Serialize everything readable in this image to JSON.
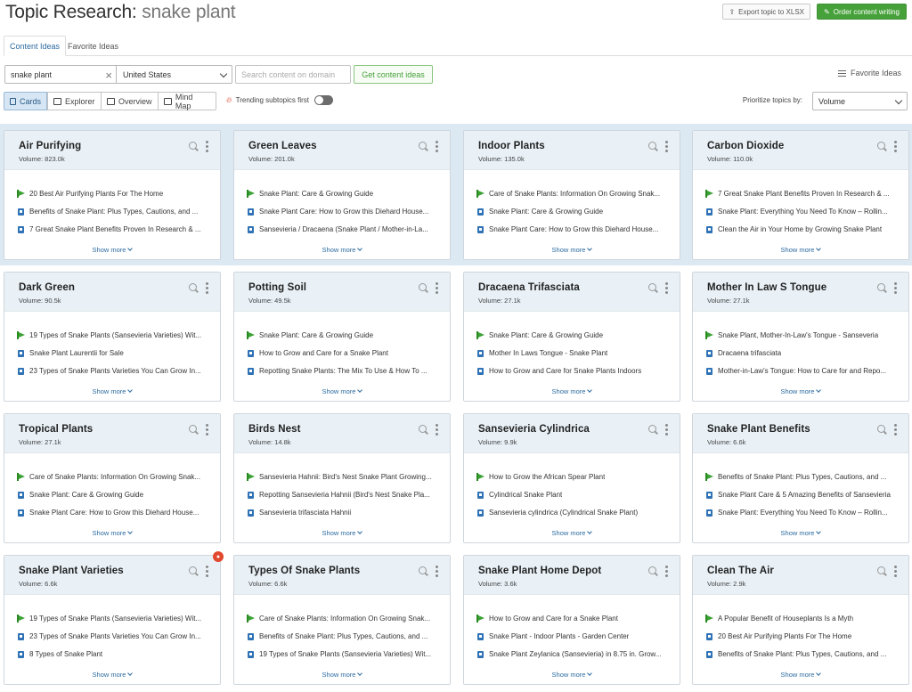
{
  "header": {
    "title_prefix": "Topic Research:",
    "keyword": "snake plant",
    "export_label": "Export topic to XLSX",
    "order_label": "Order content writing"
  },
  "tabs": [
    {
      "label": "Content Ideas",
      "active": true
    },
    {
      "label": "Favorite Ideas",
      "active": false
    }
  ],
  "search": {
    "keyword_value": "snake plant",
    "country_value": "United States",
    "domain_placeholder": "Search content on domain",
    "get_ideas_label": "Get content ideas",
    "favorite_ideas_label": "Favorite Ideas"
  },
  "views": [
    {
      "label": "Cards",
      "icon": "cards-icon",
      "active": true
    },
    {
      "label": "Explorer",
      "icon": "table-icon",
      "active": false
    },
    {
      "label": "Overview",
      "icon": "overview-icon",
      "active": false
    },
    {
      "label": "Mind Map",
      "icon": "mindmap-icon",
      "active": false
    }
  ],
  "trending_label": "Trending subtopics first",
  "trending_on": false,
  "prioritize_label": "Prioritize topics by:",
  "prioritize_value": "Volume",
  "colors": {
    "green": "#47a13b",
    "blue": "#2c6ba0",
    "header_bg": "#e9f1f7",
    "band_bg": "#dce8f2"
  },
  "cards": [
    {
      "title": "Air Purifying",
      "volume": "Volume: 823.0k",
      "items": [
        {
          "type": "green",
          "text": "20 Best Air Purifying Plants For The Home"
        },
        {
          "type": "blue",
          "text": "Benefits of Snake Plant: Plus Types, Cautions, and ..."
        },
        {
          "type": "blue",
          "text": "7 Great Snake Plant Benefits Proven In Research & ..."
        }
      ],
      "show_more": "Show more"
    },
    {
      "title": "Green Leaves",
      "volume": "Volume: 201.0k",
      "items": [
        {
          "type": "green",
          "text": "Snake Plant: Care & Growing Guide"
        },
        {
          "type": "blue",
          "text": "Snake Plant Care: How to Grow this Diehard House..."
        },
        {
          "type": "blue",
          "text": "Sansevieria / Dracaena (Snake Plant / Mother-in-La..."
        }
      ],
      "show_more": "Show more"
    },
    {
      "title": "Indoor Plants",
      "volume": "Volume: 135.0k",
      "items": [
        {
          "type": "green",
          "text": "Care of Snake Plants: Information On Growing Snak..."
        },
        {
          "type": "blue",
          "text": "Snake Plant: Care & Growing Guide"
        },
        {
          "type": "blue",
          "text": "Snake Plant Care: How to Grow this Diehard House..."
        }
      ],
      "show_more": "Show more"
    },
    {
      "title": "Carbon Dioxide",
      "volume": "Volume: 110.0k",
      "items": [
        {
          "type": "green",
          "text": "7 Great Snake Plant Benefits Proven In Research & ..."
        },
        {
          "type": "blue",
          "text": "Snake Plant: Everything You Need To Know – Rollin..."
        },
        {
          "type": "blue",
          "text": "Clean the Air in Your Home by Growing Snake Plant"
        }
      ],
      "show_more": "Show more"
    },
    {
      "title": "Dark Green",
      "volume": "Volume: 90.5k",
      "items": [
        {
          "type": "green",
          "text": "19 Types of Snake Plants (Sansevieria Varieties) Wit..."
        },
        {
          "type": "blue",
          "text": "Snake Plant Laurentii for Sale"
        },
        {
          "type": "blue",
          "text": "23 Types of Snake Plants Varieties You Can Grow In..."
        }
      ],
      "show_more": "Show more"
    },
    {
      "title": "Potting Soil",
      "volume": "Volume: 49.5k",
      "items": [
        {
          "type": "green",
          "text": "Snake Plant: Care & Growing Guide"
        },
        {
          "type": "blue",
          "text": "How to Grow and Care for a Snake Plant"
        },
        {
          "type": "blue",
          "text": "Repotting Snake Plants: The Mix To Use & How To ..."
        }
      ],
      "show_more": "Show more"
    },
    {
      "title": "Dracaena Trifasciata",
      "volume": "Volume: 27.1k",
      "items": [
        {
          "type": "green",
          "text": "Snake Plant: Care & Growing Guide"
        },
        {
          "type": "blue",
          "text": "Mother In Laws Tongue - Snake Plant"
        },
        {
          "type": "blue",
          "text": "How to Grow and Care for Snake Plants Indoors"
        }
      ],
      "show_more": "Show more"
    },
    {
      "title": "Mother In Law S Tongue",
      "volume": "Volume: 27.1k",
      "items": [
        {
          "type": "green",
          "text": "Snake Plant, Mother-In-Law's Tongue - Sanseveria"
        },
        {
          "type": "blue",
          "text": "Dracaena trifasciata"
        },
        {
          "type": "blue",
          "text": "Mother-in-Law's Tongue: How to Care for and Repo..."
        }
      ],
      "show_more": "Show more"
    },
    {
      "title": "Tropical Plants",
      "volume": "Volume: 27.1k",
      "items": [
        {
          "type": "green",
          "text": "Care of Snake Plants: Information On Growing Snak..."
        },
        {
          "type": "blue",
          "text": "Snake Plant: Care & Growing Guide"
        },
        {
          "type": "blue",
          "text": "Snake Plant Care: How to Grow this Diehard House..."
        }
      ],
      "show_more": "Show more"
    },
    {
      "title": "Birds Nest",
      "volume": "Volume: 14.8k",
      "items": [
        {
          "type": "green",
          "text": "Sansevieria Hahnii: Bird's Nest Snake Plant Growing..."
        },
        {
          "type": "blue",
          "text": "Repotting Sansevieria Hahnii (Bird's Nest Snake Pla..."
        },
        {
          "type": "blue",
          "text": "Sansevieria trifasciata Hahnii"
        }
      ],
      "show_more": "Show more"
    },
    {
      "title": "Sansevieria Cylindrica",
      "volume": "Volume: 9.9k",
      "items": [
        {
          "type": "green",
          "text": "How to Grow the African Spear Plant"
        },
        {
          "type": "blue",
          "text": "Cylindrical Snake Plant"
        },
        {
          "type": "blue",
          "text": "Sansevieria cylindrica (Cylindrical Snake Plant)"
        }
      ],
      "show_more": "Show more"
    },
    {
      "title": "Snake Plant Benefits",
      "volume": "Volume: 6.6k",
      "items": [
        {
          "type": "green",
          "text": "Benefits of Snake Plant: Plus Types, Cautions, and ..."
        },
        {
          "type": "blue",
          "text": "Snake Plant Care & 5 Amazing Benefits of Sansevieria"
        },
        {
          "type": "blue",
          "text": "Snake Plant: Everything You Need To Know – Rollin..."
        }
      ],
      "show_more": "Show more"
    },
    {
      "title": "Snake Plant Varieties",
      "volume": "Volume: 6.6k",
      "trending": true,
      "items": [
        {
          "type": "green",
          "text": "19 Types of Snake Plants (Sansevieria Varieties) Wit..."
        },
        {
          "type": "blue",
          "text": "23 Types of Snake Plants Varieties You Can Grow In..."
        },
        {
          "type": "blue",
          "text": "8 Types of Snake Plant"
        }
      ],
      "show_more": "Show more"
    },
    {
      "title": "Types Of Snake Plants",
      "volume": "Volume: 6.6k",
      "items": [
        {
          "type": "green",
          "text": "Care of Snake Plants: Information On Growing Snak..."
        },
        {
          "type": "blue",
          "text": "Benefits of Snake Plant: Plus Types, Cautions, and ..."
        },
        {
          "type": "blue",
          "text": "19 Types of Snake Plants (Sansevieria Varieties) Wit..."
        }
      ],
      "show_more": "Show more"
    },
    {
      "title": "Snake Plant Home Depot",
      "volume": "Volume: 3.6k",
      "items": [
        {
          "type": "green",
          "text": "How to Grow and Care for a Snake Plant"
        },
        {
          "type": "blue",
          "text": "Snake Plant - Indoor Plants - Garden Center"
        },
        {
          "type": "blue",
          "text": "Snake Plant Zeylanica (Sansevieria) in 8.75 in. Grow..."
        }
      ],
      "show_more": "Show more"
    },
    {
      "title": "Clean The Air",
      "volume": "Volume: 2.9k",
      "items": [
        {
          "type": "green",
          "text": "A Popular Benefit of Houseplants Is a Myth"
        },
        {
          "type": "blue",
          "text": "20 Best Air Purifying Plants For The Home"
        },
        {
          "type": "blue",
          "text": "Benefits of Snake Plant: Plus Types, Cautions, and ..."
        }
      ],
      "show_more": "Show more"
    }
  ]
}
